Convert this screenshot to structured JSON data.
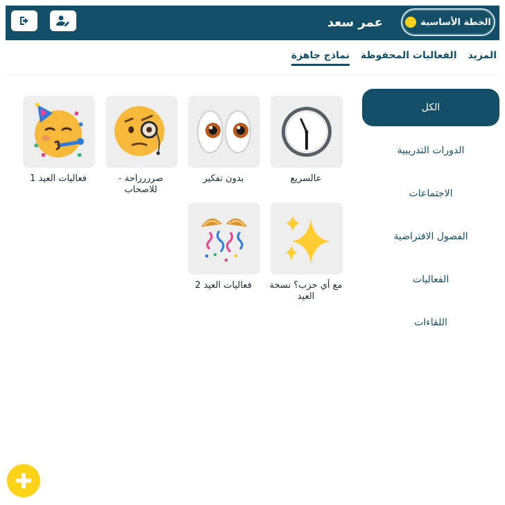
{
  "header": {
    "plan_label": "الخطة الأساسية",
    "username": "عمر سعد"
  },
  "tabs": [
    {
      "label": "نماذج جاهزة",
      "active": true
    },
    {
      "label": "الفعاليات المحفوظة",
      "active": false
    },
    {
      "label": "المزيد",
      "active": false
    }
  ],
  "sidebar": {
    "items": [
      {
        "label": "الكل",
        "active": true
      },
      {
        "label": "الدورات التدريبية"
      },
      {
        "label": "الاجتماعات"
      },
      {
        "label": "الفصول الافتراضية"
      },
      {
        "label": "الفعاليات"
      },
      {
        "label": "اللقاءات"
      }
    ]
  },
  "templates": [
    {
      "icon": "clock-icon",
      "label": "عالسريع"
    },
    {
      "icon": "eyes-icon",
      "label": "بدون تفكير"
    },
    {
      "icon": "monocle-face-icon",
      "label": "صرررراحة - للاصحاب"
    },
    {
      "icon": "party-face-icon",
      "label": "فعاليات العيد 1"
    },
    {
      "icon": "sparkles-icon",
      "label": "مع أي حزب؟ نسخة العيد"
    },
    {
      "icon": "confetti-ball-icon",
      "label": "فعاليات العيد 2"
    }
  ],
  "colors": {
    "primary": "#134f66",
    "accent": "#ffd21a",
    "tile_bg": "#eeeeee"
  }
}
